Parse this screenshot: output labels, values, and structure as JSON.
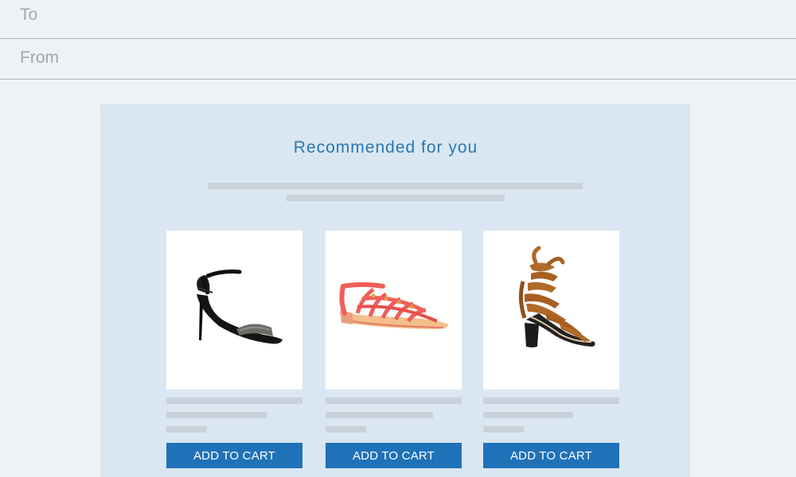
{
  "compose": {
    "to_label": "To",
    "from_label": "From"
  },
  "email": {
    "headline": "Recommended for you",
    "products": [
      {
        "name": "black-strappy-heel",
        "button_label": "ADD TO CART"
      },
      {
        "name": "coral-gladiator-sandal",
        "button_label": "ADD TO CART"
      },
      {
        "name": "tan-lace-up-block-heel",
        "button_label": "ADD TO CART"
      }
    ]
  },
  "colors": {
    "background": "#eef2f6",
    "card_background": "#dae7f2",
    "headline": "#2a77b3",
    "button": "#1f72b8",
    "placeholder_line": "#c9d1d9"
  }
}
